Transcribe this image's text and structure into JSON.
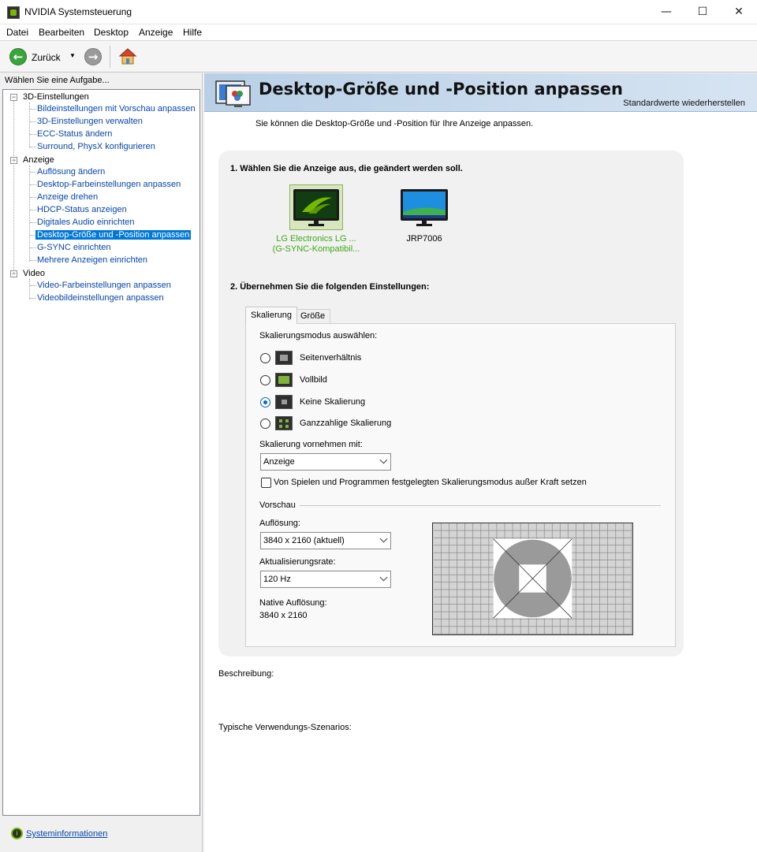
{
  "window": {
    "title": "NVIDIA Systemsteuerung",
    "minimize_glyph": "—",
    "maximize_glyph": "☐",
    "close_glyph": "✕"
  },
  "menu": [
    {
      "label": "Datei"
    },
    {
      "label": "Bearbeiten"
    },
    {
      "label": "Desktop"
    },
    {
      "label": "Anzeige"
    },
    {
      "label": "Hilfe"
    }
  ],
  "toolbar": {
    "back_label": "Zurück",
    "back_icon": "arrow-left-icon",
    "forward_icon": "arrow-right-icon",
    "home_icon": "home-icon"
  },
  "sidebar": {
    "header": "Wählen Sie eine Aufgabe...",
    "groups": [
      {
        "label": "3D-Einstellungen",
        "items": [
          {
            "label": "Bildeinstellungen mit Vorschau anpassen"
          },
          {
            "label": "3D-Einstellungen verwalten"
          },
          {
            "label": "ECC-Status ändern"
          },
          {
            "label": "Surround, PhysX konfigurieren"
          }
        ]
      },
      {
        "label": "Anzeige",
        "items": [
          {
            "label": "Auflösung ändern"
          },
          {
            "label": "Desktop-Farbeinstellungen anpassen"
          },
          {
            "label": "Anzeige drehen"
          },
          {
            "label": "HDCP-Status anzeigen"
          },
          {
            "label": "Digitales Audio einrichten"
          },
          {
            "label": "Desktop-Größe und -Position anpassen"
          },
          {
            "label": "G-SYNC einrichten"
          },
          {
            "label": "Mehrere Anzeigen einrichten"
          }
        ]
      },
      {
        "label": "Video",
        "items": [
          {
            "label": "Video-Farbeinstellungen anpassen"
          },
          {
            "label": "Videobildeinstellungen anpassen"
          }
        ]
      }
    ],
    "selected": "Desktop-Größe und -Position anpassen",
    "footer_link": "Systeminformationen"
  },
  "page": {
    "title": "Desktop-Größe und -Position anpassen",
    "restore_defaults": "Standardwerte wiederherstellen",
    "subtitle": "Sie können die Desktop-Größe und -Position für Ihre Anzeige anpassen.",
    "step1": "1. Wählen Sie die Anzeige aus, die geändert werden soll.",
    "displays": [
      {
        "line1": "LG Electronics LG ...",
        "line2": "(G-SYNC-Kompatibil...",
        "selected": true
      },
      {
        "line1": "JRP7006",
        "line2": "",
        "selected": false
      }
    ],
    "step2": "2. Übernehmen Sie die folgenden Einstellungen:",
    "tabs": [
      {
        "label": "Skalierung",
        "active": true
      },
      {
        "label": "Größe",
        "active": false
      }
    ],
    "scaling": {
      "mode_label": "Skalierungsmodus auswählen:",
      "modes": [
        {
          "label": "Seitenverhältnis",
          "checked": false
        },
        {
          "label": "Vollbild",
          "checked": false
        },
        {
          "label": "Keine Skalierung",
          "checked": true
        },
        {
          "label": "Ganzzahlige Skalierung",
          "checked": false
        }
      ],
      "perform_label": "Skalierung vornehmen mit:",
      "perform_value": "Anzeige",
      "override_label": "Von Spielen und Programmen festgelegten Skalierungsmodus außer Kraft setzen",
      "override_checked": false
    },
    "preview": {
      "section_label": "Vorschau",
      "resolution_label": "Auflösung:",
      "resolution_value": "3840 x 2160 (aktuell)",
      "refresh_label": "Aktualisierungsrate:",
      "refresh_value": "120 Hz",
      "native_label": "Native Auflösung:",
      "native_value": "3840 x 2160"
    },
    "description_label": "Beschreibung:",
    "usage_label": "Typische Verwendungs-Szenarios:"
  },
  "colors": {
    "nvidia_green": "#76b900",
    "link_blue": "#0645ad",
    "selection_blue": "#0078d7",
    "radio_blue": "#0067c0",
    "selected_display_text": "#3daa14"
  }
}
